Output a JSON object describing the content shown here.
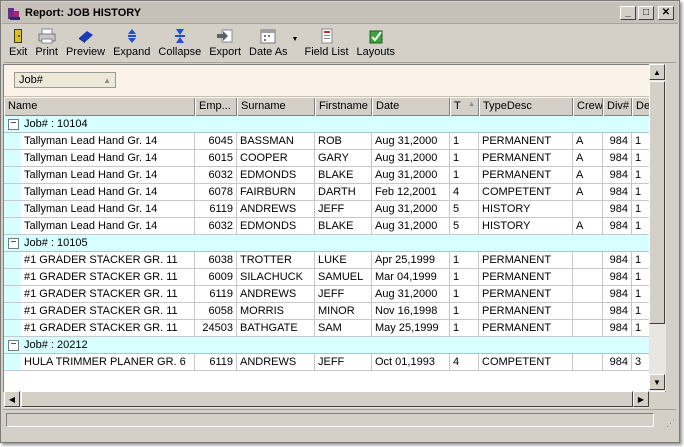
{
  "window": {
    "title": "Report: JOB HISTORY",
    "minimize_glyph": "_",
    "maximize_glyph": "□",
    "close_glyph": "✕"
  },
  "toolbar": {
    "exit_label": "Exit",
    "print_label": "Print",
    "preview_label": "Preview",
    "expand_label": "Expand",
    "collapse_label": "Collapse",
    "export_label": "Export",
    "date_as_label": "Date As",
    "field_list_label": "Field List",
    "layouts_label": "Layouts"
  },
  "groupby": {
    "chip_label": "Job#"
  },
  "columns": [
    "Name",
    "Emp...",
    "Surname",
    "Firstname",
    "Date",
    "T",
    "TypeDesc",
    "Crew",
    "Div#",
    "Dep"
  ],
  "groups": [
    {
      "label": "Job# : 10104",
      "rows": [
        [
          "Tallyman Lead Hand Gr. 14",
          "6045",
          "BASSMAN",
          "ROB",
          "Aug 31,2000",
          "1",
          "PERMANENT",
          "A",
          "984",
          "1"
        ],
        [
          "Tallyman Lead Hand Gr. 14",
          "6015",
          "COOPER",
          "GARY",
          "Aug 31,2000",
          "1",
          "PERMANENT",
          "A",
          "984",
          "1"
        ],
        [
          "Tallyman Lead Hand Gr. 14",
          "6032",
          "EDMONDS",
          "BLAKE",
          "Aug 31,2000",
          "1",
          "PERMANENT",
          "A",
          "984",
          "1"
        ],
        [
          "Tallyman Lead Hand Gr. 14",
          "6078",
          "FAIRBURN",
          "DARTH",
          "Feb 12,2001",
          "4",
          "COMPETENT",
          "A",
          "984",
          "1"
        ],
        [
          "Tallyman Lead Hand Gr. 14",
          "6119",
          "ANDREWS",
          "JEFF",
          "Aug 31,2000",
          "5",
          "HISTORY",
          "",
          "984",
          "1"
        ],
        [
          "Tallyman Lead Hand Gr. 14",
          "6032",
          "EDMONDS",
          "BLAKE",
          "Aug 31,2000",
          "5",
          "HISTORY",
          "A",
          "984",
          "1"
        ]
      ]
    },
    {
      "label": "Job# : 10105",
      "rows": [
        [
          "#1 GRADER STACKER GR. 11",
          "6038",
          "TROTTER",
          "LUKE",
          "Apr 25,1999",
          "1",
          "PERMANENT",
          "",
          "984",
          "1"
        ],
        [
          "#1 GRADER STACKER GR. 11",
          "6009",
          "SILACHUCK",
          "SAMUEL",
          "Mar 04,1999",
          "1",
          "PERMANENT",
          "",
          "984",
          "1"
        ],
        [
          "#1 GRADER STACKER GR. 11",
          "6119",
          "ANDREWS",
          "JEFF",
          "Aug 31,2000",
          "1",
          "PERMANENT",
          "",
          "984",
          "1"
        ],
        [
          "#1 GRADER STACKER GR. 11",
          "6058",
          "MORRIS",
          "MINOR",
          "Nov 16,1998",
          "1",
          "PERMANENT",
          "",
          "984",
          "1"
        ],
        [
          "#1 GRADER STACKER GR. 11",
          "24503",
          "BATHGATE",
          "SAM",
          "May 25,1999",
          "1",
          "PERMANENT",
          "",
          "984",
          "1"
        ]
      ]
    },
    {
      "label": "Job# : 20212",
      "rows": [
        [
          "HULA TRIMMER PLANER GR. 6",
          "6119",
          "ANDREWS",
          "JEFF",
          "Oct 01,1993",
          "4",
          "COMPETENT",
          "",
          "984",
          "3"
        ]
      ]
    }
  ],
  "toggle_glyph": "−",
  "colors": {
    "group_row_bg": "#d8ffff",
    "groupbox_bg": "#fbf3e8",
    "chrome": "#d4d0c8"
  }
}
